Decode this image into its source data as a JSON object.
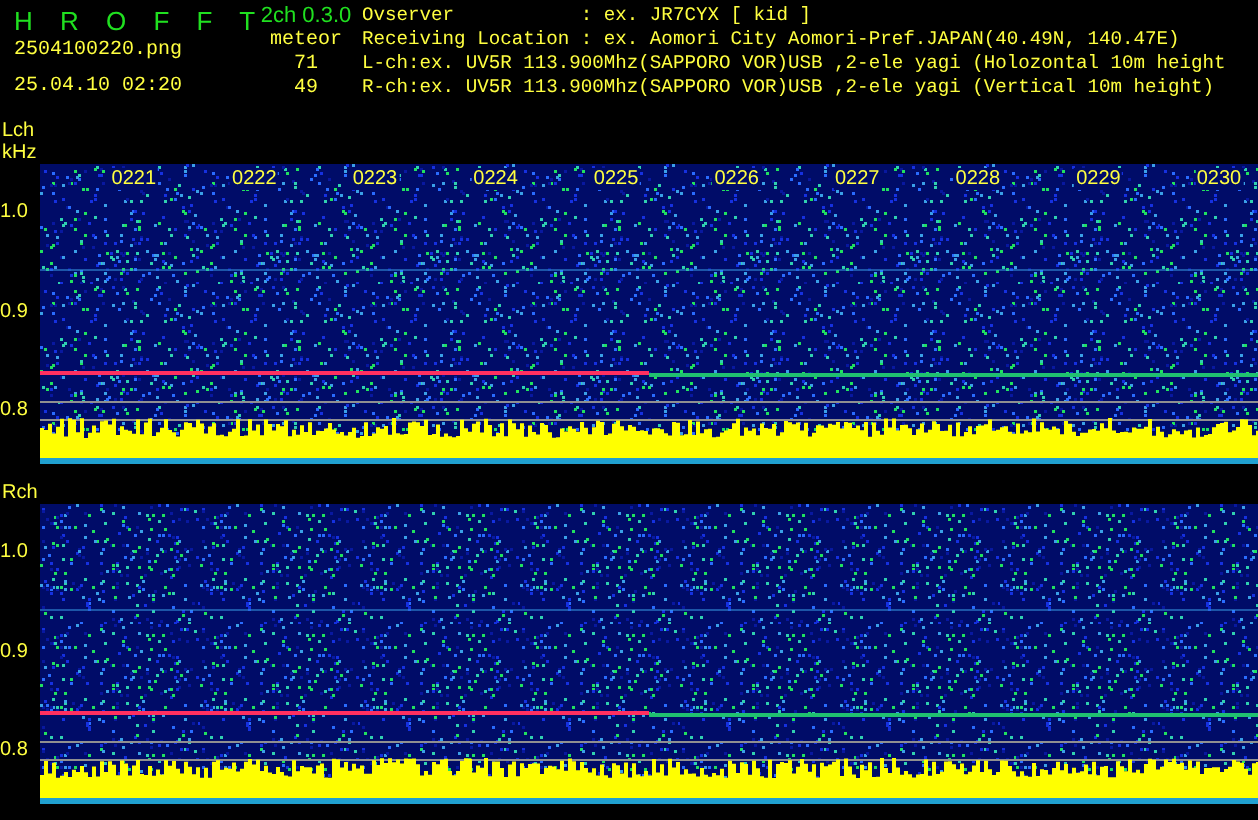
{
  "header": {
    "app_title": "H R O F F T",
    "version": "2ch 0.3.0",
    "filename": "2504100220.png",
    "datetime": "25.04.10 02:20",
    "count_label": "meteor",
    "counts": [
      "71",
      "49"
    ],
    "info_lines": [
      "Ovserver           : ex. JR7CYX [ kid ]",
      "Receiving Location : ex. Aomori City Aomori-Pref.JAPAN(40.49N, 140.47E)",
      "L-ch:ex. UV5R 113.900Mhz(SAPPORO VOR)USB ,2-ele yagi (Holozontal 10m height",
      "R-ch:ex. UV5R 113.900Mhz(SAPPORO VOR)USB ,2-ele yagi (Vertical 10m height)"
    ]
  },
  "panels": [
    {
      "channel": "Lch",
      "unit": "kHz",
      "time_labels": [
        "0221",
        "0222",
        "0223",
        "0224",
        "0225",
        "0226",
        "0227",
        "0228",
        "0229",
        "0230"
      ],
      "y_labels": [
        "1.0",
        "0.9",
        "0.8"
      ]
    },
    {
      "channel": "Rch",
      "y_labels": [
        "1.0",
        "0.9",
        "0.8"
      ]
    }
  ]
}
